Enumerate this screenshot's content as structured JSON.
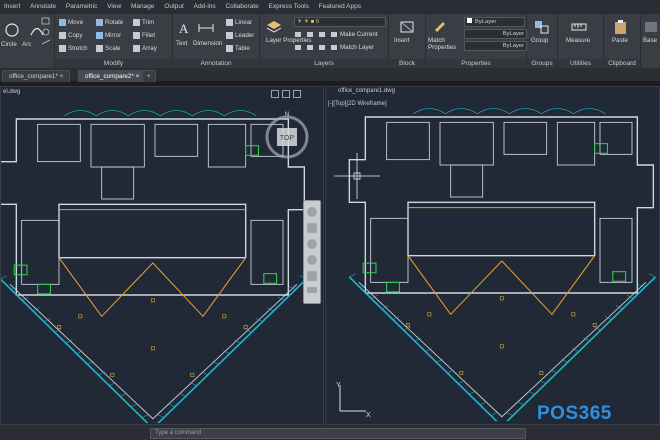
{
  "menu": [
    "Insert",
    "Annotate",
    "Parametric",
    "View",
    "Manage",
    "Output",
    "Add-ins",
    "Collaborate",
    "Express Tools",
    "Featured Apps"
  ],
  "ribbon": {
    "draw_tools": [
      "Circle",
      "Arc"
    ],
    "modify": {
      "label": "Modify",
      "tools": [
        "Move",
        "Rotate",
        "Trim",
        "Copy",
        "Mirror",
        "Fillet",
        "Stretch",
        "Scale",
        "Array"
      ]
    },
    "annotation": {
      "label": "Annotation",
      "big_tools": [
        "Text",
        "Dimension"
      ],
      "tools": [
        "Linear",
        "Leader",
        "Table"
      ]
    },
    "layers": {
      "label": "Layers",
      "big_tool": "Layer Properties",
      "tools": [
        "Make Current",
        "Match Layer"
      ]
    },
    "block": {
      "label": "Block",
      "tools": [
        "Insert"
      ]
    },
    "properties": {
      "label": "Properties",
      "big_tool": "Match Properties",
      "combos": [
        "ByLayer",
        "ByLayer",
        "ByLayer"
      ]
    },
    "groups": {
      "label": "Groups",
      "tools": [
        "Group"
      ]
    },
    "utilities": {
      "label": "Utilities",
      "tools": [
        "Measure"
      ]
    },
    "clipboard": {
      "label": "Clipboard",
      "tools": [
        "Paste"
      ]
    },
    "view": {
      "label": "Base"
    }
  },
  "tabs": [
    "office_compare1*",
    "office_compare2*"
  ],
  "left_viewport": {
    "title": "el.dwg"
  },
  "right_viewport": {
    "title": "office_compare1.dwg",
    "label": "[-][Top][2D Wireframe]"
  },
  "command": {
    "placeholder": "Type a command"
  },
  "ucs": {
    "x": "X",
    "y": "Y"
  },
  "brand": {
    "text": "POS365"
  },
  "colors": {
    "background": "#212836",
    "wall": "#cfd6e4",
    "orange": "#e1a032",
    "cyan": "#1fb5c8",
    "green": "#2bd14b",
    "brand_blue": "#2f8fe0"
  },
  "viewcube": {
    "label": "TOP"
  }
}
